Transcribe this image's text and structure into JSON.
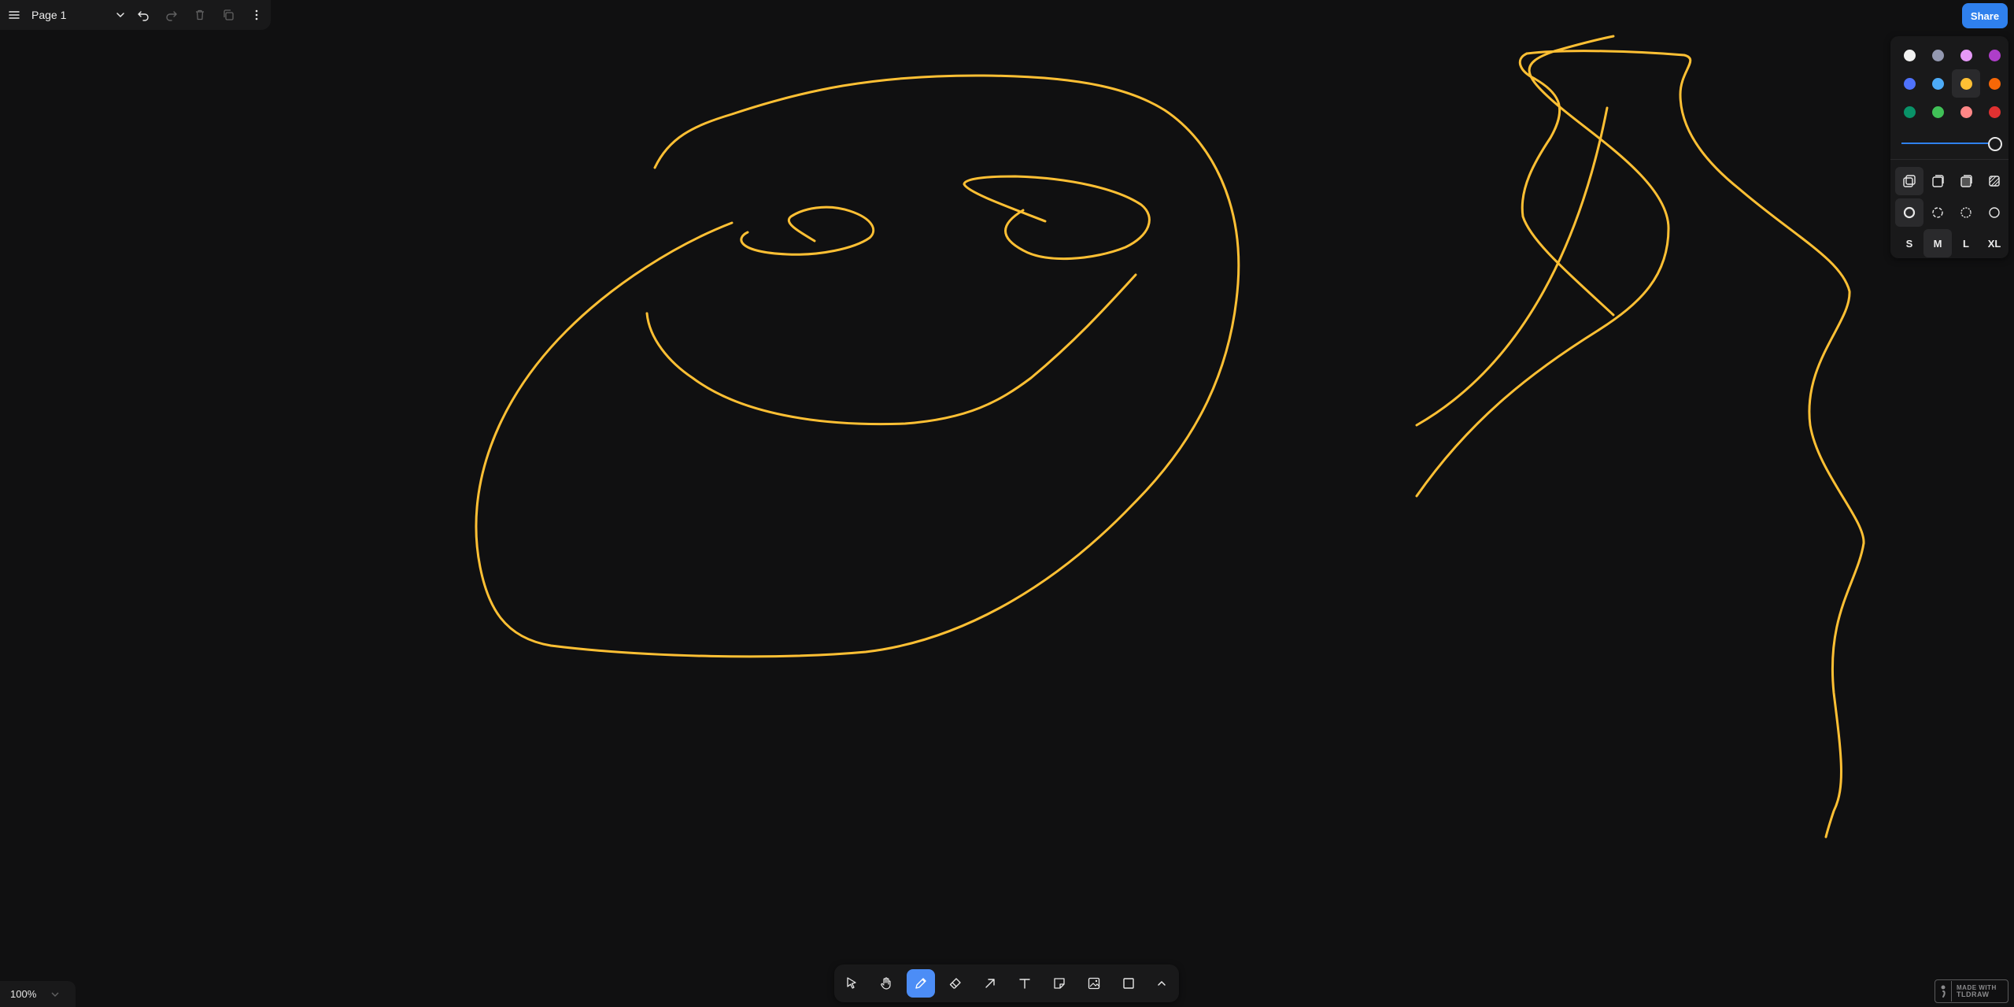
{
  "menu": {
    "page_name": "Page 1"
  },
  "share": {
    "label": "Share"
  },
  "style_panel": {
    "colors": [
      {
        "name": "white",
        "hex": "#f2f2f2"
      },
      {
        "name": "grey",
        "hex": "#9398b0"
      },
      {
        "name": "light-violet",
        "hex": "#e599f7"
      },
      {
        "name": "violet",
        "hex": "#ae3ec9"
      },
      {
        "name": "blue",
        "hex": "#4f72fc"
      },
      {
        "name": "light-blue",
        "hex": "#4dabf7"
      },
      {
        "name": "yellow",
        "hex": "#ffc034"
      },
      {
        "name": "orange",
        "hex": "#f76707"
      },
      {
        "name": "green",
        "hex": "#099268"
      },
      {
        "name": "light-green",
        "hex": "#40c057"
      },
      {
        "name": "light-red",
        "hex": "#ff8787"
      },
      {
        "name": "red",
        "hex": "#e03131"
      }
    ],
    "selected_color": "yellow",
    "opacity": 1.0,
    "fill_options": [
      "none",
      "semi",
      "solid",
      "pattern"
    ],
    "dash_options": [
      "draw",
      "dashed",
      "dotted",
      "solid"
    ],
    "sizes": [
      "S",
      "M",
      "L",
      "XL"
    ],
    "selected_size": "M"
  },
  "toolbar": {
    "tools": [
      "select",
      "hand",
      "draw",
      "eraser",
      "arrow",
      "text",
      "note",
      "asset",
      "rectangle",
      "more"
    ],
    "selected_tool": "draw"
  },
  "zoom": {
    "label": "100%"
  },
  "watermark": {
    "line1": "MADE WITH",
    "line2": "TLDRAW"
  },
  "stroke_color": "#ffc034"
}
